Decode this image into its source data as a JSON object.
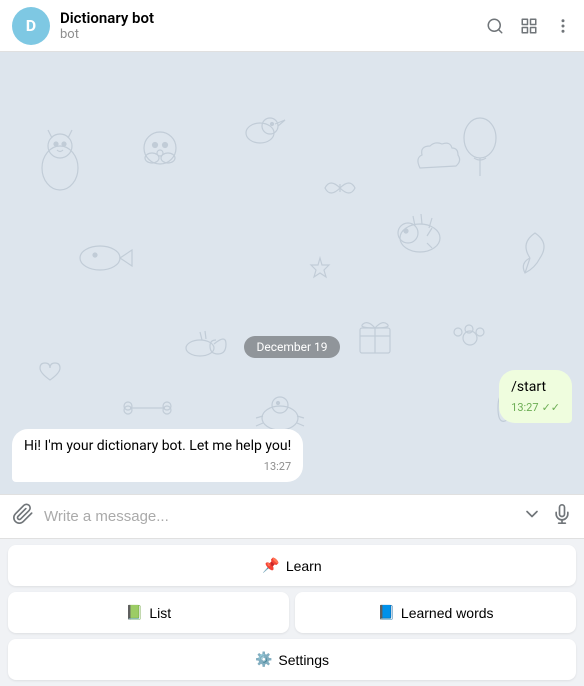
{
  "header": {
    "title": "Dictionary bot",
    "subtitle": "bot",
    "avatar_letter": "D"
  },
  "chat": {
    "date_badge": "December 19",
    "messages": [
      {
        "id": "msg-start",
        "side": "right",
        "text": "/start",
        "time": "13:27",
        "has_check": true
      },
      {
        "id": "msg-reply",
        "side": "left",
        "text": "Hi! I'm your dictionary bot. Let me help you!",
        "time": "13:27",
        "has_check": false
      }
    ]
  },
  "input": {
    "placeholder": "Write a message..."
  },
  "bot_buttons": {
    "row1": [
      {
        "id": "btn-learn",
        "emoji": "📌",
        "label": "Learn",
        "full": true
      }
    ],
    "row2": [
      {
        "id": "btn-list",
        "emoji": "📗",
        "label": "List"
      },
      {
        "id": "btn-learned",
        "emoji": "📘",
        "label": "Learned words"
      }
    ],
    "row3": [
      {
        "id": "btn-settings",
        "emoji": "⚙️",
        "label": "Settings",
        "full": true
      }
    ]
  },
  "icons": {
    "search": "🔍",
    "layout": "⬜",
    "more": "⋮",
    "attach": "📎",
    "chevron_down": "⌄",
    "mic": "🎤"
  }
}
